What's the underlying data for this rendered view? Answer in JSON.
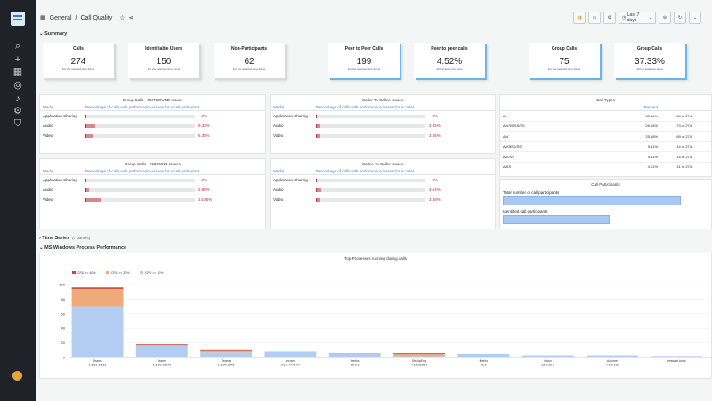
{
  "breadcrumb": {
    "root": "General",
    "sep": "/",
    "page": "Call Quality"
  },
  "toolbar": {
    "time_range": "Last 7 days"
  },
  "sections": {
    "summary": "Summary",
    "time_series": "Time Series",
    "time_series_count": "(7 panels)",
    "ms_windows": "MS Windows Process Performance"
  },
  "stats": [
    {
      "title": "Calls",
      "value": "274",
      "sub": "For the selected time frame"
    },
    {
      "title": "Identifiable Users",
      "value": "150",
      "sub": "For the selected time frame"
    },
    {
      "title": "Non-Participants",
      "value": "62",
      "sub": "For the selected time frame"
    },
    {
      "title": "Peer to Peer Calls",
      "value": "199",
      "sub": "For the selected time frame"
    },
    {
      "title": "Peer to peer calls",
      "value": "4.52%",
      "sub": "with at least one issue"
    },
    {
      "title": "Group Calls",
      "value": "75",
      "sub": "For the selected time frame"
    },
    {
      "title": "Group Calls",
      "value": "37.33%",
      "sub": "with at least one issue"
    }
  ],
  "issue_tables": [
    {
      "title": "Group Calls - OUTBOUND Issues",
      "col_media": "Media",
      "col_pct": "Percentage of calls with performance issues for a call participant",
      "rows": [
        {
          "media": "Application Sharing",
          "value": 0,
          "label": "0%"
        },
        {
          "media": "Audio",
          "value": 9.33,
          "label": "9.33%"
        },
        {
          "media": "Video",
          "value": 6.35,
          "label": "6.35%"
        }
      ]
    },
    {
      "title": "Caller To Callee Issues",
      "col_media": "Media",
      "col_pct": "Percentage of calls with performance issues for a caller",
      "rows": [
        {
          "media": "Application Sharing",
          "value": 0,
          "label": "0%"
        },
        {
          "media": "Audio",
          "value": 3.05,
          "label": "3.05%"
        },
        {
          "media": "Video",
          "value": 3.05,
          "label": "3.05%"
        }
      ]
    },
    {
      "title": "Group Calls - INBOUND Issues",
      "col_media": "Media",
      "col_pct": "Percentage of calls with performance issues for a call participant",
      "rows": [
        {
          "media": "Application Sharing",
          "value": 0,
          "label": "0%"
        },
        {
          "media": "Audio",
          "value": 2.86,
          "label": "2.86%"
        },
        {
          "media": "Video",
          "value": 14.85,
          "label": "14.85%"
        }
      ]
    },
    {
      "title": "Callee To Caller Issues",
      "col_media": "Media",
      "col_pct": "Percentage of calls with performance issues for a caller",
      "rows": [
        {
          "media": "Application Sharing",
          "value": 0,
          "label": "0%"
        },
        {
          "media": "Audio",
          "value": 4.54,
          "label": "4.54%"
        },
        {
          "media": "Video",
          "value": 3.88,
          "label": "3.88%"
        }
      ]
    }
  ],
  "call_types": {
    "title": "Call Types",
    "col_percent": "Percent",
    "rows": [
      {
        "type": "A",
        "percent": "30.66%",
        "count": "84 of 274"
      },
      {
        "type": "A/V/VBSS/SS",
        "percent": "26.64%",
        "count": "73 of 274"
      },
      {
        "type": "A/V",
        "percent": "25.18%",
        "count": "69 of 274"
      },
      {
        "type": "A/VBSS/SS",
        "percent": "5.11%",
        "count": "14 of 274"
      },
      {
        "type": "A/V/SS",
        "percent": "5.11%",
        "count": "14 of 274"
      },
      {
        "type": "A/SS",
        "percent": "4.01%",
        "count": "11 of 274"
      }
    ]
  },
  "call_participants": {
    "title": "Call Participants",
    "total_label": "Total number of call participants",
    "identified_label": "Identified call participants"
  },
  "chart_data": {
    "type": "bar",
    "title": "Top Processes running during calls",
    "stacked": true,
    "ylim": [
      0,
      100
    ],
    "yticks": [
      0,
      20,
      40,
      60,
      80,
      100
    ],
    "categories": [
      "Teams 1.6.00.11161",
      "Teams 1.6.00.13073",
      "Teams 1.6.00.8473",
      "chrome 91.0.4472.77",
      "firefox 88.0.1",
      "MsMpEng 4.18.2105.4",
      "firefox 89.0",
      "rdbox 12.1.16.0",
      "Acrome 4.0.0.110",
      "vmware-tools"
    ],
    "series": [
      {
        "name": "CPU >= 40%",
        "color": "#c2473f",
        "values": [
          2,
          1,
          1,
          0,
          0,
          1,
          0,
          0,
          0,
          0
        ]
      },
      {
        "name": "CPU >= 30%",
        "color": "#f0aa79",
        "values": [
          24,
          1,
          2,
          0,
          1,
          3,
          0,
          0,
          0,
          0
        ]
      },
      {
        "name": "CPU >= 10%",
        "color": "#b3cdf2",
        "values": [
          70,
          16,
          7,
          8,
          5,
          2,
          5,
          3,
          3,
          2
        ]
      }
    ]
  }
}
